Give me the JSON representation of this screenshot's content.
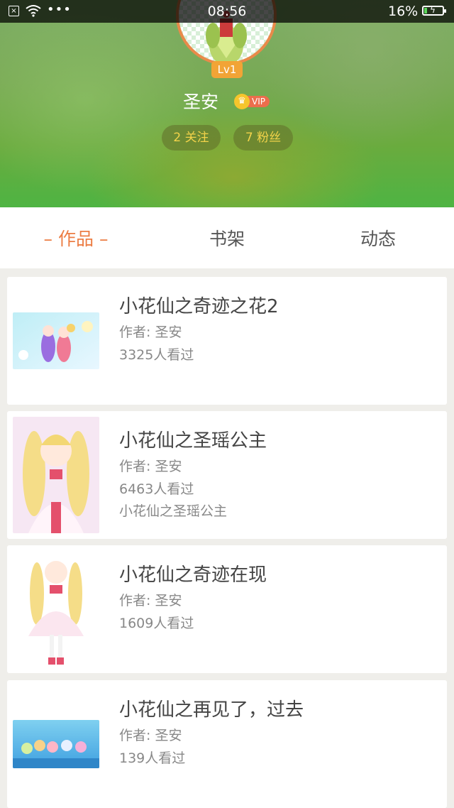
{
  "status_bar": {
    "time": "08:56",
    "battery": "16%",
    "battery_level": 0.16,
    "dots": "•••"
  },
  "profile": {
    "level": "Lv1",
    "username": "圣安",
    "vip_label": "VIP",
    "following": "2 关注",
    "fans": "7 粉丝"
  },
  "tabs": [
    {
      "label": "– 作品 –",
      "active": true
    },
    {
      "label": "书架",
      "active": false
    },
    {
      "label": "动态",
      "active": false
    }
  ],
  "works": [
    {
      "title": "小花仙之奇迹之花2",
      "author": "作者: 圣安",
      "views": "3325人看过",
      "extra": ""
    },
    {
      "title": "小花仙之圣瑶公主",
      "author": "作者: 圣安",
      "views": "6463人看过",
      "extra": "小花仙之圣瑶公主"
    },
    {
      "title": "小花仙之奇迹在现",
      "author": "作者: 圣安",
      "views": "1609人看过",
      "extra": ""
    },
    {
      "title": "小花仙之再见了，过去",
      "author": "作者: 圣安",
      "views": "139人看过",
      "extra": ""
    }
  ],
  "colors": {
    "accent": "#ec7d44",
    "level_badge": "#f2a436",
    "pill_text": "#f3d34a",
    "vip": "#ec6d4c"
  }
}
